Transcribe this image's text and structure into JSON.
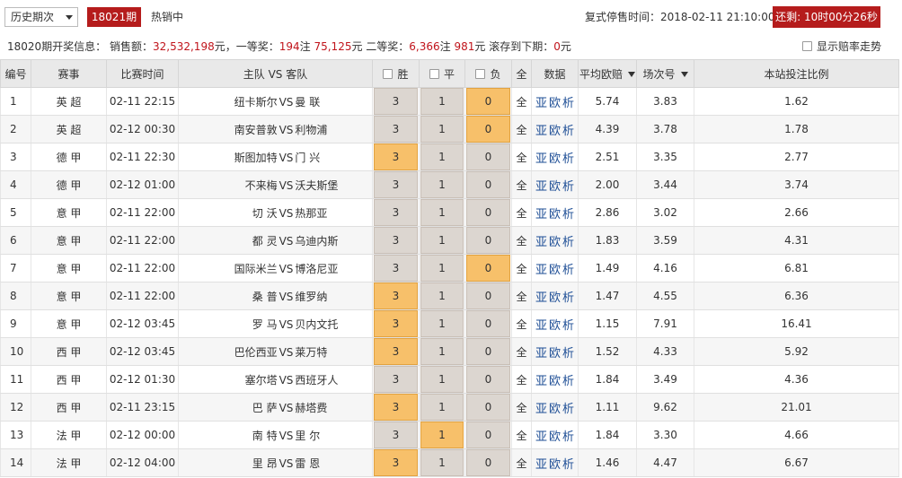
{
  "toolbar": {
    "period_select": "历史期次",
    "issue": "18021期",
    "hot_label": "热销中",
    "stop_time_label": "复式停售时间：",
    "stop_time": "2018-02-11 21:10:00",
    "countdown": "还剩: 10时00分26秒"
  },
  "info": {
    "prefix": "18020期开奖信息：  销售额：",
    "sales": "32,532,198",
    "unit1": "元，一等奖：",
    "first_count": "194",
    "note1": "注 ",
    "first_prize": "75,125",
    "unit2": "元  二等奖：",
    "second_count": "6,366",
    "note2": "注 ",
    "second_prize": "981",
    "unit3": "元 滚存到下期：",
    "rollover": "0",
    "unit4": "元",
    "trend_label": "显示赔率走势"
  },
  "headers": {
    "no": "编号",
    "league": "赛事",
    "time": "比赛时间",
    "teams": "主队 VS 客队",
    "win": "胜",
    "draw": "平",
    "lose": "负",
    "all": "全",
    "data": "数据",
    "avg_odds": "平均欧赔",
    "field_no": "场次号",
    "ratio": "本站投注比例"
  },
  "rows": [
    {
      "no": "1",
      "league": "英  超",
      "time": "02-11 22:15",
      "home": "纽卡斯尔",
      "away": "曼  联",
      "w": "3",
      "d": "1",
      "l": "0",
      "sel": "l",
      "all": "全",
      "links": [
        "亚",
        "欧",
        "析"
      ],
      "o1": "5.74",
      "o2": "3.83",
      "o3": "1.62"
    },
    {
      "no": "2",
      "league": "英  超",
      "time": "02-12 00:30",
      "home": "南安普敦",
      "away": "利物浦",
      "w": "3",
      "d": "1",
      "l": "0",
      "sel": "l",
      "all": "全",
      "links": [
        "亚",
        "欧",
        "析"
      ],
      "o1": "4.39",
      "o2": "3.78",
      "o3": "1.78"
    },
    {
      "no": "3",
      "league": "德  甲",
      "time": "02-11 22:30",
      "home": "斯图加特",
      "away": "门  兴",
      "w": "3",
      "d": "1",
      "l": "0",
      "sel": "w",
      "all": "全",
      "links": [
        "亚",
        "欧",
        "析"
      ],
      "o1": "2.51",
      "o2": "3.35",
      "o3": "2.77"
    },
    {
      "no": "4",
      "league": "德  甲",
      "time": "02-12 01:00",
      "home": "不来梅",
      "away": "沃夫斯堡",
      "w": "3",
      "d": "1",
      "l": "0",
      "sel": "",
      "all": "全",
      "links": [
        "亚",
        "欧",
        "析"
      ],
      "o1": "2.00",
      "o2": "3.44",
      "o3": "3.74"
    },
    {
      "no": "5",
      "league": "意  甲",
      "time": "02-11 22:00",
      "home": "切  沃",
      "away": "热那亚",
      "w": "3",
      "d": "1",
      "l": "0",
      "sel": "",
      "all": "全",
      "links": [
        "亚",
        "欧",
        "析"
      ],
      "o1": "2.86",
      "o2": "3.02",
      "o3": "2.66"
    },
    {
      "no": "6",
      "league": "意  甲",
      "time": "02-11 22:00",
      "home": "都  灵",
      "away": "乌迪内斯",
      "w": "3",
      "d": "1",
      "l": "0",
      "sel": "",
      "all": "全",
      "links": [
        "亚",
        "欧",
        "析"
      ],
      "o1": "1.83",
      "o2": "3.59",
      "o3": "4.31"
    },
    {
      "no": "7",
      "league": "意  甲",
      "time": "02-11 22:00",
      "home": "国际米兰",
      "away": "博洛尼亚",
      "w": "3",
      "d": "1",
      "l": "0",
      "sel": "l",
      "all": "全",
      "links": [
        "亚",
        "欧",
        "析"
      ],
      "o1": "1.49",
      "o2": "4.16",
      "o3": "6.81"
    },
    {
      "no": "8",
      "league": "意  甲",
      "time": "02-11 22:00",
      "home": "桑  普",
      "away": "维罗纳",
      "w": "3",
      "d": "1",
      "l": "0",
      "sel": "w",
      "all": "全",
      "links": [
        "亚",
        "欧",
        "析"
      ],
      "o1": "1.47",
      "o2": "4.55",
      "o3": "6.36"
    },
    {
      "no": "9",
      "league": "意  甲",
      "time": "02-12 03:45",
      "home": "罗  马",
      "away": "贝内文托",
      "w": "3",
      "d": "1",
      "l": "0",
      "sel": "w",
      "all": "全",
      "links": [
        "亚",
        "欧",
        "析"
      ],
      "o1": "1.15",
      "o2": "7.91",
      "o3": "16.41"
    },
    {
      "no": "10",
      "league": "西  甲",
      "time": "02-12 03:45",
      "home": "巴伦西亚",
      "away": "莱万特",
      "w": "3",
      "d": "1",
      "l": "0",
      "sel": "w",
      "all": "全",
      "links": [
        "亚",
        "欧",
        "析"
      ],
      "o1": "1.52",
      "o2": "4.33",
      "o3": "5.92"
    },
    {
      "no": "11",
      "league": "西  甲",
      "time": "02-12 01:30",
      "home": "塞尔塔",
      "away": "西班牙人",
      "w": "3",
      "d": "1",
      "l": "0",
      "sel": "",
      "all": "全",
      "links": [
        "亚",
        "欧",
        "析"
      ],
      "o1": "1.84",
      "o2": "3.49",
      "o3": "4.36"
    },
    {
      "no": "12",
      "league": "西  甲",
      "time": "02-11 23:15",
      "home": "巴  萨",
      "away": "赫塔费",
      "w": "3",
      "d": "1",
      "l": "0",
      "sel": "w",
      "all": "全",
      "links": [
        "亚",
        "欧",
        "析"
      ],
      "o1": "1.11",
      "o2": "9.62",
      "o3": "21.01"
    },
    {
      "no": "13",
      "league": "法  甲",
      "time": "02-12 00:00",
      "home": "南  特",
      "away": "里  尔",
      "w": "3",
      "d": "1",
      "l": "0",
      "sel": "d",
      "all": "全",
      "links": [
        "亚",
        "欧",
        "析"
      ],
      "o1": "1.84",
      "o2": "3.30",
      "o3": "4.66"
    },
    {
      "no": "14",
      "league": "法  甲",
      "time": "02-12 04:00",
      "home": "里  昂",
      "away": "雷  恩",
      "w": "3",
      "d": "1",
      "l": "0",
      "sel": "w",
      "all": "全",
      "links": [
        "亚",
        "欧",
        "析"
      ],
      "o1": "1.46",
      "o2": "4.47",
      "o3": "6.67"
    }
  ]
}
